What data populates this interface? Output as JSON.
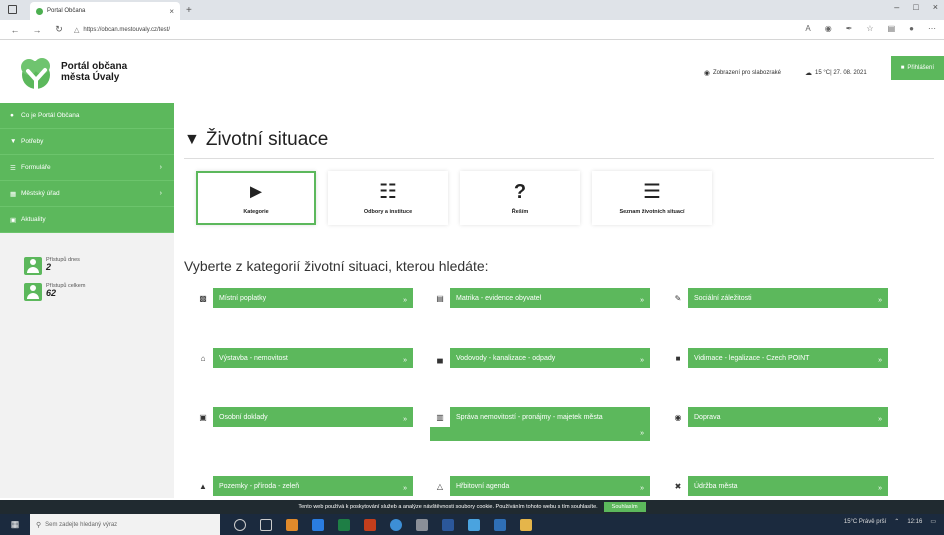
{
  "browser": {
    "tab_title": "Portal Občana",
    "tab_close": "×",
    "new_tab": "+",
    "url": "https://obcan.mestouvaly.cz/test/",
    "window_controls": [
      "–",
      "□",
      "×"
    ]
  },
  "header": {
    "brand_line1": "Portál občana",
    "brand_line2": "města Úvaly",
    "low_vision_label": "Zobrazení pro slabozraké",
    "weather_date": "15 °C| 27. 08. 2021",
    "login_label": "Přihlášení"
  },
  "sidebar": {
    "items": [
      {
        "label": "Co je Portál Občana",
        "icon": "info-icon",
        "arrow": ""
      },
      {
        "label": "Potřeby",
        "icon": "needs-icon",
        "arrow": ""
      },
      {
        "label": "Formuláře",
        "icon": "forms-icon",
        "arrow": "›"
      },
      {
        "label": "Městský úřad",
        "icon": "office-icon",
        "arrow": "›"
      },
      {
        "label": "Aktuality",
        "icon": "news-icon",
        "arrow": ""
      }
    ],
    "stats": [
      {
        "label": "Přístupů dnes",
        "value": "2"
      },
      {
        "label": "Přístupů celkem",
        "value": "62"
      }
    ]
  },
  "main": {
    "title": "Životní situace",
    "tiles": [
      {
        "label": "Kategorie",
        "icon": "tag-icon"
      },
      {
        "label": "Odbory a instituce",
        "icon": "org-chart-icon"
      },
      {
        "label": "Řeším",
        "icon": "question-icon"
      },
      {
        "label": "Seznam životních situací",
        "icon": "list-icon"
      }
    ],
    "subtitle": "Vyberte z kategorií životní situaci, kterou hledáte:",
    "categories": [
      {
        "label": "Místní poplatky",
        "icon": "money-icon"
      },
      {
        "label": "Matrika - evidence obyvatel",
        "icon": "book-icon"
      },
      {
        "label": "Sociální záležitosti",
        "icon": "handshake-icon"
      },
      {
        "label": "Výstavba - nemovitost",
        "icon": "home-icon"
      },
      {
        "label": "Vodovody - kanalizace - odpady",
        "icon": "industry-icon"
      },
      {
        "label": "Vidimace - legalizace - Czech POINT",
        "icon": "document-icon"
      },
      {
        "label": "Osobní doklady",
        "icon": "id-card-icon"
      },
      {
        "label": "Správa nemovitostí - pronájmy - majetek města",
        "icon": "building-icon"
      },
      {
        "label": "Doprava",
        "icon": "car-icon"
      },
      {
        "label": "Pozemky - příroda - zeleň",
        "icon": "tree-icon"
      },
      {
        "label": "Hřbitovní agenda",
        "icon": "cemetery-icon"
      },
      {
        "label": "Údržba města",
        "icon": "tools-icon"
      }
    ],
    "chevron": "»"
  },
  "cookie": {
    "text": "Tento web používá k poskytování služeb a analýze návštěvnosti soubory cookie. Používáním tohoto webu s tím souhlasíte.",
    "button": "Souhlasím"
  },
  "taskbar": {
    "search_placeholder": "Sem zadejte hledaný výraz",
    "weather": "15°C Právě prší",
    "time": "12:16"
  }
}
